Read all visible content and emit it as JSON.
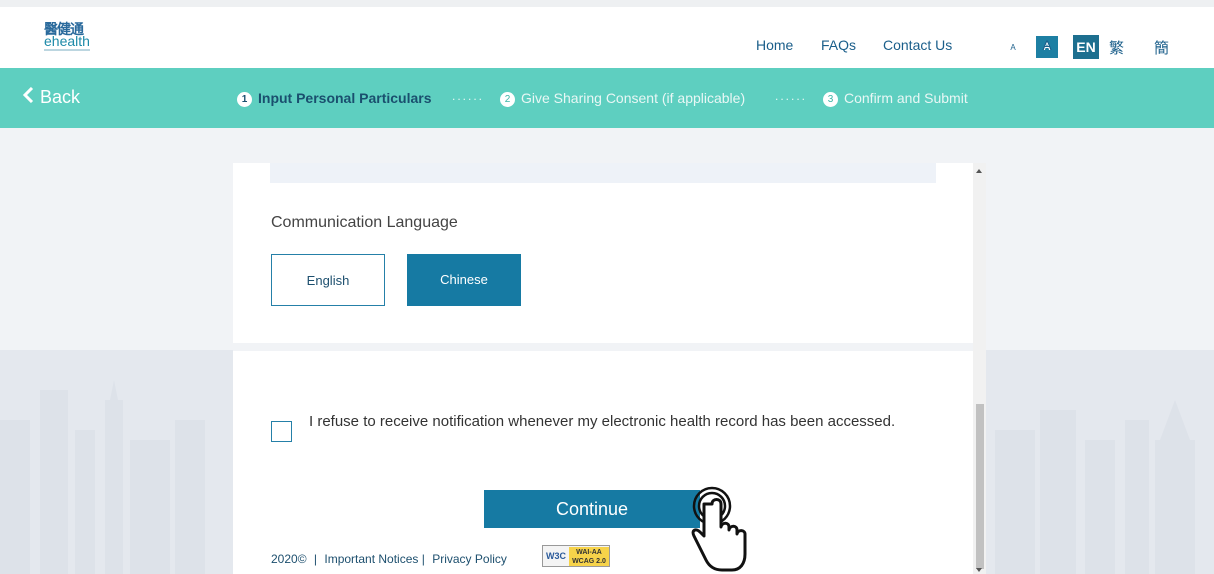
{
  "header": {
    "logo_cn": "醫健通",
    "logo_en": "ehealth",
    "nav": {
      "home": "Home",
      "faqs": "FAQs",
      "contact": "Contact Us"
    },
    "font_size": {
      "small": "A",
      "medium": "A",
      "large": "A"
    },
    "lang": {
      "en": "EN",
      "tc": "繁",
      "sc": "簡"
    }
  },
  "stepbar": {
    "back": "Back",
    "steps": [
      {
        "num": "1",
        "label": "Input Personal Particulars",
        "active": true
      },
      {
        "num": "2",
        "label": "Give Sharing Consent (if applicable)",
        "active": false
      },
      {
        "num": "3",
        "label": "Confirm and Submit",
        "active": false
      }
    ],
    "separator": "......"
  },
  "form": {
    "section_title": "Communication Language",
    "options": [
      {
        "label": "English",
        "selected": false
      },
      {
        "label": "Chinese",
        "selected": true
      }
    ],
    "refuse_notification_text": "I refuse to receive notification whenever my electronic health record has been accessed.",
    "refuse_notification_checked": false,
    "continue_label": "Continue"
  },
  "footer": {
    "copyright": "2020©",
    "important_notices": "Important Notices",
    "privacy_policy": "Privacy Policy",
    "badge_w3c": "W3C",
    "badge_wcag": "WAI-AA WCAG 2.0"
  },
  "colors": {
    "accent": "#167aa3",
    "stepbar": "#5ecfc0",
    "background": "#f1f3f6"
  }
}
